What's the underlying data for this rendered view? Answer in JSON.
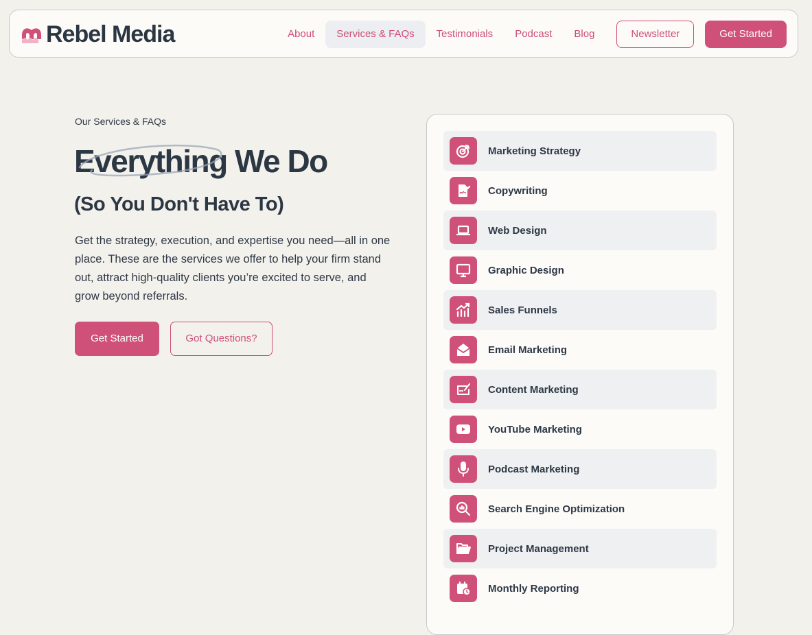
{
  "brand": {
    "name": "Rebel Media",
    "accent": "#cf5078",
    "text": "#2c3744"
  },
  "nav": {
    "links": [
      {
        "label": "About",
        "active": false
      },
      {
        "label": "Services & FAQs",
        "active": true
      },
      {
        "label": "Testimonials",
        "active": false
      },
      {
        "label": "Podcast",
        "active": false
      },
      {
        "label": "Blog",
        "active": false
      }
    ],
    "newsletter_label": "Newsletter",
    "get_started_label": "Get Started"
  },
  "hero": {
    "eyebrow": "Our Services & FAQs",
    "title_highlight": "Everything",
    "title_rest": " We Do",
    "subtitle": "(So You Don't Have To)",
    "description": "Get the strategy, execution, and expertise you need—all in one place. These are the services we offer to help your firm stand out, attract high-quality clients you’re excited to serve, and grow beyond referrals.",
    "primary_cta": "Get Started",
    "secondary_cta": "Got Questions?"
  },
  "services": [
    {
      "label": "Marketing Strategy",
      "icon": "target-icon"
    },
    {
      "label": "Copywriting",
      "icon": "signature-document-icon"
    },
    {
      "label": "Web Design",
      "icon": "laptop-icon"
    },
    {
      "label": "Graphic Design",
      "icon": "monitor-icon"
    },
    {
      "label": "Sales Funnels",
      "icon": "chart-growth-icon"
    },
    {
      "label": "Email Marketing",
      "icon": "envelope-open-icon"
    },
    {
      "label": "Content Marketing",
      "icon": "edit-pen-icon"
    },
    {
      "label": "YouTube Marketing",
      "icon": "youtube-play-icon"
    },
    {
      "label": "Podcast Marketing",
      "icon": "microphone-icon"
    },
    {
      "label": "Search Engine Optimization",
      "icon": "search-chart-icon"
    },
    {
      "label": "Project Management",
      "icon": "folder-open-icon"
    },
    {
      "label": "Monthly Reporting",
      "icon": "calendar-clock-icon"
    }
  ]
}
